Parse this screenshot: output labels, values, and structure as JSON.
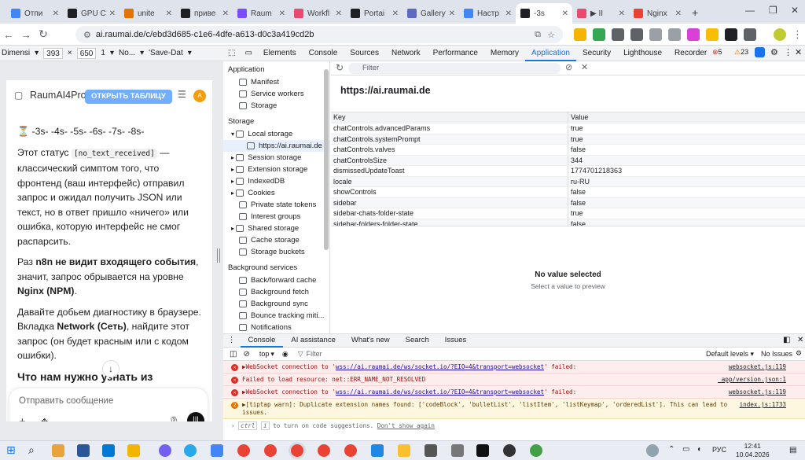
{
  "tabs": [
    {
      "label": "Отпи",
      "color": "#4285f4",
      "active": false
    },
    {
      "label": "GPU C",
      "color": "#202124",
      "active": false
    },
    {
      "label": "unite",
      "color": "#e37400",
      "active": false
    },
    {
      "label": "приве",
      "color": "#202124",
      "active": false
    },
    {
      "label": "Raum",
      "color": "#7c4dff",
      "active": false
    },
    {
      "label": "Workfl",
      "color": "#ea4b71",
      "active": false
    },
    {
      "label": "Portai",
      "color": "#202124",
      "active": false
    },
    {
      "label": "Gallery",
      "color": "#5c6bc0",
      "active": false
    },
    {
      "label": "Настр",
      "color": "#4285f4",
      "active": false
    },
    {
      "label": "-3s",
      "color": "#202124",
      "active": true
    },
    {
      "label": "▶ II",
      "color": "#ea4b71",
      "active": false
    },
    {
      "label": "Nginx",
      "color": "#ea4335",
      "active": false
    }
  ],
  "address": {
    "url": "ai.raumai.de/c/ebd3d685-c1e6-4dfe-a613-d0c3a419cd2b"
  },
  "devicebar": {
    "dimensions": "Dimensi",
    "width": "393",
    "x": "×",
    "height": "650",
    "dpr": "1",
    "throttle": "No...",
    "save": "'Save-Dat"
  },
  "chat": {
    "model_name": "RaumAI4Pro",
    "open_button": "ОТКРЫТЬ ТАБЛИЦУ",
    "avatar_initial": "A",
    "timer_line": "⏳ -3s- -4s- -5s- -6s- -7s- -8s-",
    "p1_before": "Этот статус ",
    "p1_code": "[no_text_received]",
    "p1_after": " — классический симптом того, что фронтенд (ваш интерфейс) отправил запрос и ожидал получить JSON или текст, но в ответ пришло «ничего» или ошибка, которую интерфейс не смог распарсить.",
    "p2_a": "Раз ",
    "p2_bold": "n8n не видит входящего события",
    "p2_b": ", значит, запрос обрывается на уровне ",
    "p2_bold2": "Nginx (NPM)",
    "p2_c": ".",
    "p3_a": "Давайте добьем диагностику в браузере. Вкладка ",
    "p3_bold": "Network (Сеть)",
    "p3_b": ", найдите этот запрос (он будет красным или с кодом ошибки).",
    "heading": "Что нам нужно узнать из",
    "composer_placeholder": "Отправить сообщение"
  },
  "devtools": {
    "tabs": [
      "Elements",
      "Console",
      "Sources",
      "Network",
      "Performance",
      "Memory",
      "Application",
      "Security",
      "Lighthouse",
      "Recorder"
    ],
    "active_tab": "Application",
    "errors": "5",
    "warnings": "23"
  },
  "sidebar": {
    "app_header": "Application",
    "app_items": [
      "Manifest",
      "Service workers",
      "Storage"
    ],
    "storage_header": "Storage",
    "storage_items": [
      "Local storage",
      "https://ai.raumai.de",
      "Session storage",
      "Extension storage",
      "IndexedDB",
      "Cookies",
      "Private state tokens",
      "Interest groups",
      "Shared storage",
      "Cache storage",
      "Storage buckets"
    ],
    "bg_header": "Background services",
    "bg_items": [
      "Back/forward cache",
      "Background fetch",
      "Background sync",
      "Bounce tracking miti...",
      "Notifications"
    ]
  },
  "storage": {
    "filter_placeholder": "Filter",
    "origin": "https://ai.raumai.de",
    "col_key": "Key",
    "col_value": "Value",
    "rows": [
      {
        "k": "chatControls.advancedParams",
        "v": "true"
      },
      {
        "k": "chatControls.systemPrompt",
        "v": "true"
      },
      {
        "k": "chatControls.valves",
        "v": "false"
      },
      {
        "k": "chatControlsSize",
        "v": "344"
      },
      {
        "k": "dismissedUpdateToast",
        "v": "1774701218363"
      },
      {
        "k": "locale",
        "v": "ru-RU"
      },
      {
        "k": "showControls",
        "v": "false"
      },
      {
        "k": "sidebar",
        "v": "false"
      },
      {
        "k": "sidebar-chats-folder-state",
        "v": "true"
      },
      {
        "k": "sidebar-folders-folder-state",
        "v": "false"
      }
    ],
    "no_value_title": "No value selected",
    "no_value_sub": "Select a value to preview"
  },
  "console": {
    "tabs": [
      "Console",
      "AI assistance",
      "What's new",
      "Search",
      "Issues"
    ],
    "context": "top",
    "filter": "Filter",
    "levels": "Default levels",
    "issues": "No Issues",
    "messages": [
      {
        "type": "err",
        "pre": "▶WebSocket connection to '",
        "link": "wss://ai.raumai.de/ws/socket.io/?EIO=4&transport=websocket",
        "post": "' failed:",
        "src": "websocket.js:119"
      },
      {
        "type": "err",
        "pre": "Failed to load resource: net::ERR_NAME_NOT_RESOLVED",
        "link": "",
        "post": "",
        "src": "_app/version.json:1"
      },
      {
        "type": "err",
        "pre": "▶WebSocket connection to '",
        "link": "wss://ai.raumai.de/ws/socket.io/?EIO=4&transport=websocket",
        "post": "' failed:",
        "src": "websocket.js:119"
      },
      {
        "type": "warn",
        "count": "2",
        "pre": "▶[tiptap warn]: Duplicate extension names found: ['codeBlock', 'bulletList', 'listItem', 'listKeymap', 'orderedList']. This can lead to issues.",
        "link": "",
        "post": "",
        "src": "index.js:1733"
      }
    ],
    "prompt_a": "ctrl",
    "prompt_b": "i",
    "prompt_text": " to turn on code suggestions. ",
    "prompt_link": "Don't show again"
  },
  "taskbar": {
    "time": "12:41",
    "date": "10.04.2026",
    "lang": "РУС"
  }
}
